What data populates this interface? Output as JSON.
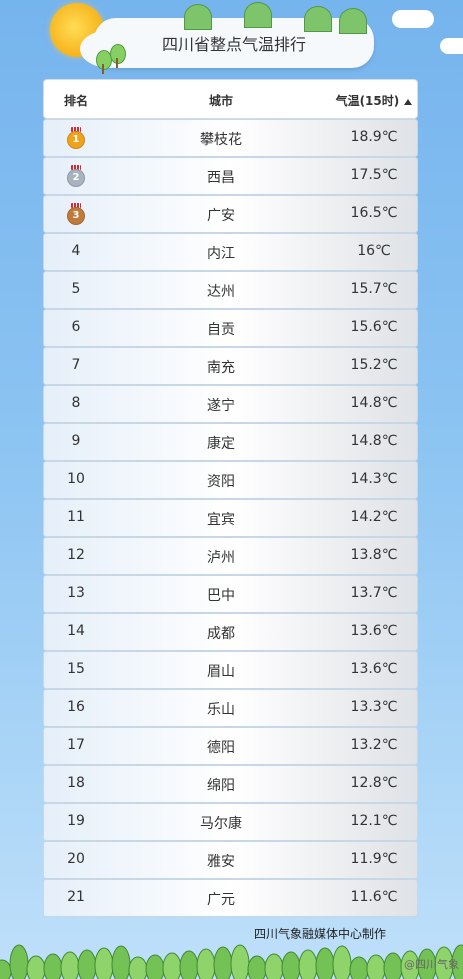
{
  "banner": {
    "title": "四川省整点气温排行"
  },
  "table": {
    "headers": {
      "rank": "排名",
      "city": "城市",
      "temp": "气温(15时)"
    },
    "sort_icon": "sort-up-icon",
    "rows": [
      {
        "rank": "1",
        "city": "攀枝花",
        "temp": "18.9℃",
        "medal": "gold"
      },
      {
        "rank": "2",
        "city": "西昌",
        "temp": "17.5℃",
        "medal": "silver"
      },
      {
        "rank": "3",
        "city": "广安",
        "temp": "16.5℃",
        "medal": "bronze"
      },
      {
        "rank": "4",
        "city": "内江",
        "temp": "16℃"
      },
      {
        "rank": "5",
        "city": "达州",
        "temp": "15.7℃"
      },
      {
        "rank": "6",
        "city": "自贡",
        "temp": "15.6℃"
      },
      {
        "rank": "7",
        "city": "南充",
        "temp": "15.2℃"
      },
      {
        "rank": "8",
        "city": "遂宁",
        "temp": "14.8℃"
      },
      {
        "rank": "9",
        "city": "康定",
        "temp": "14.8℃"
      },
      {
        "rank": "10",
        "city": "资阳",
        "temp": "14.3℃"
      },
      {
        "rank": "11",
        "city": "宜宾",
        "temp": "14.2℃"
      },
      {
        "rank": "12",
        "city": "泸州",
        "temp": "13.8℃"
      },
      {
        "rank": "13",
        "city": "巴中",
        "temp": "13.7℃"
      },
      {
        "rank": "14",
        "city": "成都",
        "temp": "13.6℃"
      },
      {
        "rank": "15",
        "city": "眉山",
        "temp": "13.6℃"
      },
      {
        "rank": "16",
        "city": "乐山",
        "temp": "13.3℃"
      },
      {
        "rank": "17",
        "city": "德阳",
        "temp": "13.2℃"
      },
      {
        "rank": "18",
        "city": "绵阳",
        "temp": "12.8℃"
      },
      {
        "rank": "19",
        "city": "马尔康",
        "temp": "12.1℃"
      },
      {
        "rank": "20",
        "city": "雅安",
        "temp": "11.9℃"
      },
      {
        "rank": "21",
        "city": "广元",
        "temp": "11.6℃"
      }
    ]
  },
  "footer": {
    "credit": "四川气象融媒体中心制作"
  },
  "watermark": {
    "text": "@四川气象"
  },
  "colors": {
    "gold": "#f0a21a",
    "silver": "#a9b3bf",
    "bronze": "#c07a3a",
    "sky": "#8cc4f2"
  }
}
